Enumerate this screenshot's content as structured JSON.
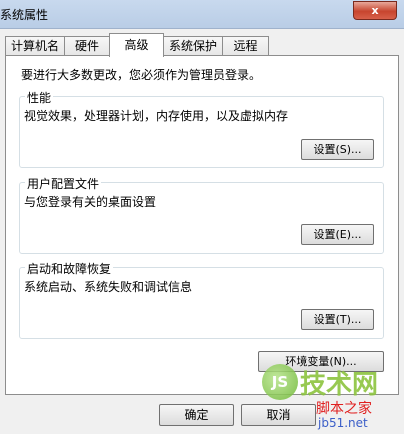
{
  "window": {
    "title": "系统属性",
    "close_glyph": "x"
  },
  "tabs": [
    {
      "label": "计算机名"
    },
    {
      "label": "硬件"
    },
    {
      "label": "高级"
    },
    {
      "label": "系统保护"
    },
    {
      "label": "远程"
    }
  ],
  "advanced": {
    "intro": "要进行大多数更改，您必须作为管理员登录。",
    "performance": {
      "label": "性能",
      "desc": "视觉效果，处理器计划，内存使用，以及虚拟内存",
      "button": "设置(S)..."
    },
    "profiles": {
      "label": "用户配置文件",
      "desc": "与您登录有关的桌面设置",
      "button": "设置(E)..."
    },
    "startup": {
      "label": "启动和故障恢复",
      "desc": "系统启动、系统失败和调试信息",
      "button": "设置(T)..."
    },
    "env_button": "环境变量(N)..."
  },
  "footer": {
    "ok": "确定",
    "cancel": "取消"
  },
  "watermark": {
    "logo": "JS",
    "title": "技术网",
    "sub": "脚本之家",
    "url": "jb51.net"
  }
}
